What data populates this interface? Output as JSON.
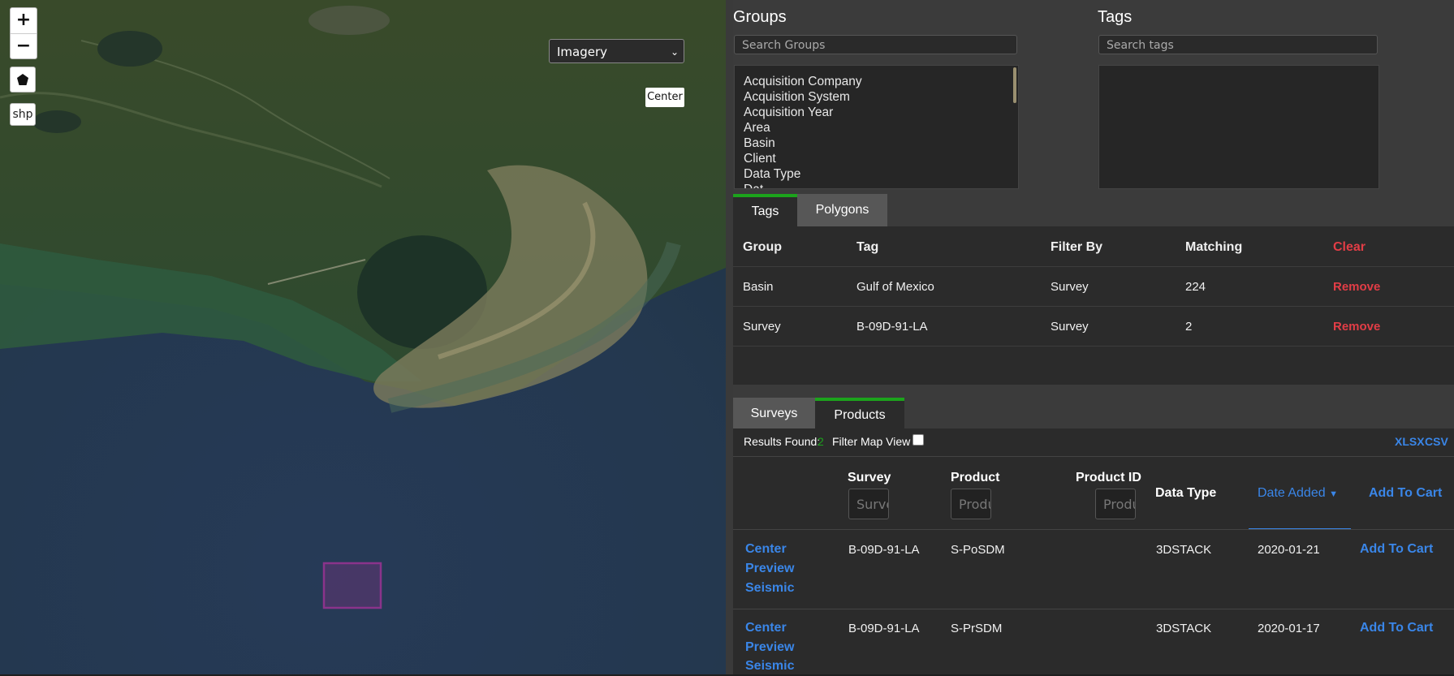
{
  "map": {
    "zoom_in_label": "+",
    "zoom_out_label": "−",
    "polygon_tool_icon": "pentagon-icon",
    "shp_label": "shp",
    "layer_select_value": "Imagery",
    "center_label": "Center"
  },
  "groups": {
    "title": "Groups",
    "search_placeholder": "Search Groups",
    "items": [
      "Acquisition Company",
      "Acquisition System",
      "Acquisition Year",
      "Area",
      "Basin",
      "Client",
      "Data Type",
      "Dat"
    ]
  },
  "tags": {
    "title": "Tags",
    "search_placeholder": "Search tags"
  },
  "filter_tabs": {
    "tags": "Tags",
    "polygons": "Polygons"
  },
  "filter_table": {
    "headers": {
      "group": "Group",
      "tag": "Tag",
      "filter_by": "Filter By",
      "matching": "Matching",
      "clear": "Clear"
    },
    "rows": [
      {
        "group": "Basin",
        "tag": "Gulf of Mexico",
        "filter_by": "Survey",
        "matching": "224",
        "action": "Remove"
      },
      {
        "group": "Survey",
        "tag": "B-09D-91-LA",
        "filter_by": "Survey",
        "matching": "2",
        "action": "Remove"
      }
    ]
  },
  "result_tabs": {
    "surveys": "Surveys",
    "products": "Products"
  },
  "results": {
    "found_label": "Results Found:",
    "found_count": "2",
    "filter_map_label": "Filter Map View",
    "xlsx": "XLSX",
    "csv": "CSV"
  },
  "products_table": {
    "headers": {
      "survey": "Survey",
      "product": "Product",
      "product_id": "Product ID",
      "data_type": "Data Type",
      "date_added": "Date Added",
      "add_to_cart": "Add To Cart"
    },
    "placeholders": {
      "survey": "Survey",
      "product": "Product",
      "product_id": "Product ID"
    },
    "rows": [
      {
        "center": "Center",
        "preview": "Preview",
        "seismic": "Seismic",
        "survey": "B-09D-91-LA",
        "product": "S-PoSDM",
        "product_id": "",
        "data_type": "3DSTACK",
        "date_added": "2020-01-21",
        "add_to_cart": "Add To Cart"
      },
      {
        "center": "Center",
        "preview": "Preview",
        "seismic": "Seismic",
        "survey": "B-09D-91-LA",
        "product": "S-PrSDM",
        "product_id": "",
        "data_type": "3DSTACK",
        "date_added": "2020-01-17",
        "add_to_cart": "Add To Cart"
      }
    ]
  },
  "colors": {
    "accent_green": "#1ca31c",
    "link_blue": "#3a86e8",
    "danger_red": "#e23d46"
  }
}
